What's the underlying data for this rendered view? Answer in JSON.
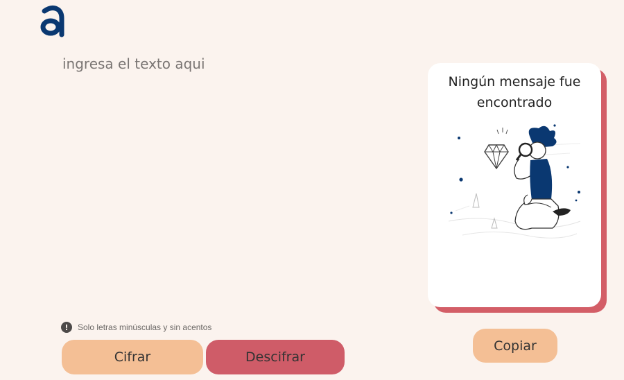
{
  "input": {
    "placeholder": "ingresa el texto aqui"
  },
  "hint": {
    "icon": "exclamation-icon",
    "text": "Solo letras minúsculas y sin acentos"
  },
  "buttons": {
    "encrypt_label": "Cifrar",
    "decrypt_label": "Descifrar",
    "copy_label": "Copiar"
  },
  "output_card": {
    "message": "Ningún mensaje fue encontrado"
  },
  "colors": {
    "background": "#fbf3ee",
    "logo": "#0a3871",
    "peach": "#f4bf95",
    "rose": "#cf5c68",
    "card_shadow": "#d35e67"
  }
}
